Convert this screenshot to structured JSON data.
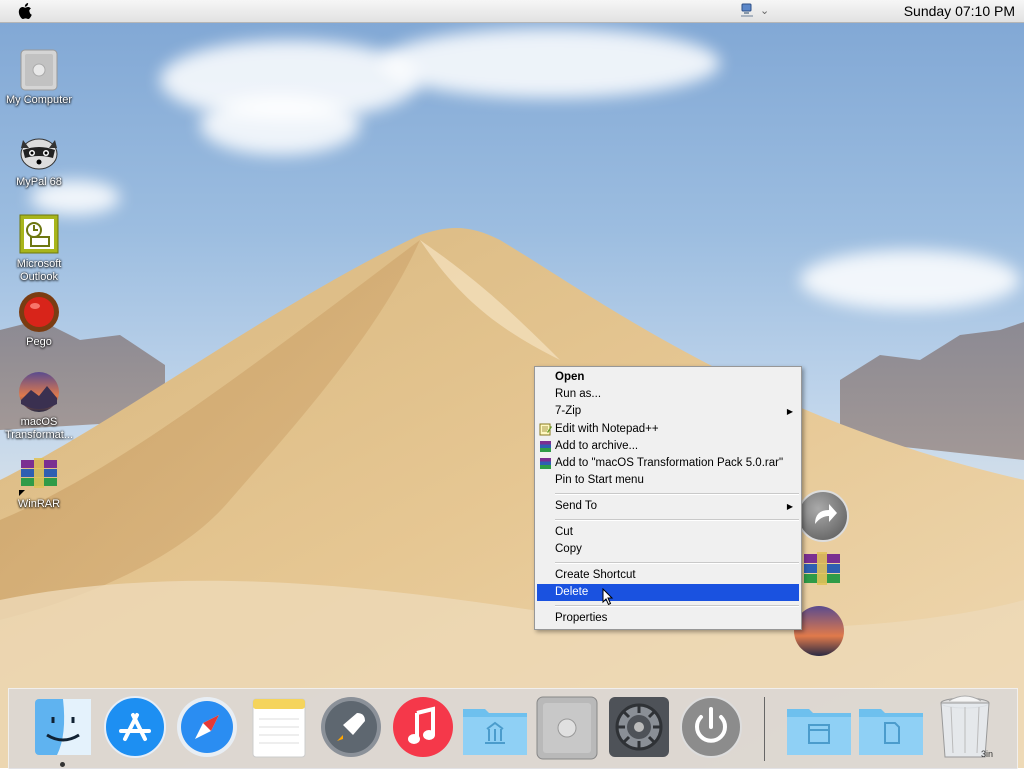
{
  "menubar": {
    "clock": "Sunday 07:10 PM"
  },
  "desktop_icons": [
    {
      "label": "My Computer",
      "icon": "computer-icon"
    },
    {
      "label": "MyPal 68",
      "icon": "raccoon-icon"
    },
    {
      "label": "Microsoft Outlook",
      "icon": "outlook-icon"
    },
    {
      "label": "Pego",
      "icon": "pego-icon"
    },
    {
      "label": "macOS Transformat...",
      "icon": "macos-icon"
    },
    {
      "label": "WinRAR",
      "icon": "winrar-icon"
    }
  ],
  "context_menu": {
    "items": [
      {
        "label": "Open",
        "bold": true
      },
      {
        "label": "Run as..."
      },
      {
        "label": "7-Zip",
        "submenu": true
      },
      {
        "label": "Edit with Notepad++",
        "icon": "notepad-icon"
      },
      {
        "label": "Add to archive...",
        "icon": "winrar-small-icon"
      },
      {
        "label": "Add to \"macOS Transformation Pack 5.0.rar\"",
        "icon": "winrar-small-icon"
      },
      {
        "label": "Pin to Start menu"
      },
      {
        "label": "Send To",
        "submenu": true
      },
      {
        "label": "Cut"
      },
      {
        "label": "Copy"
      },
      {
        "label": "Create Shortcut"
      },
      {
        "label": "Delete",
        "highlighted": true
      },
      {
        "label": "Properties"
      }
    ],
    "highlight_color": "#1a52e0"
  },
  "dock": {
    "items": [
      "finder-icon",
      "app-store-icon",
      "safari-icon",
      "notes-icon",
      "launchpad-icon",
      "music-icon",
      "applications-folder-icon",
      "mac-pro-icon",
      "system-preferences-icon",
      "power-icon",
      "documents-folder-icon",
      "downloads-folder-icon",
      "trash-icon"
    ],
    "trash_label": "3in"
  }
}
